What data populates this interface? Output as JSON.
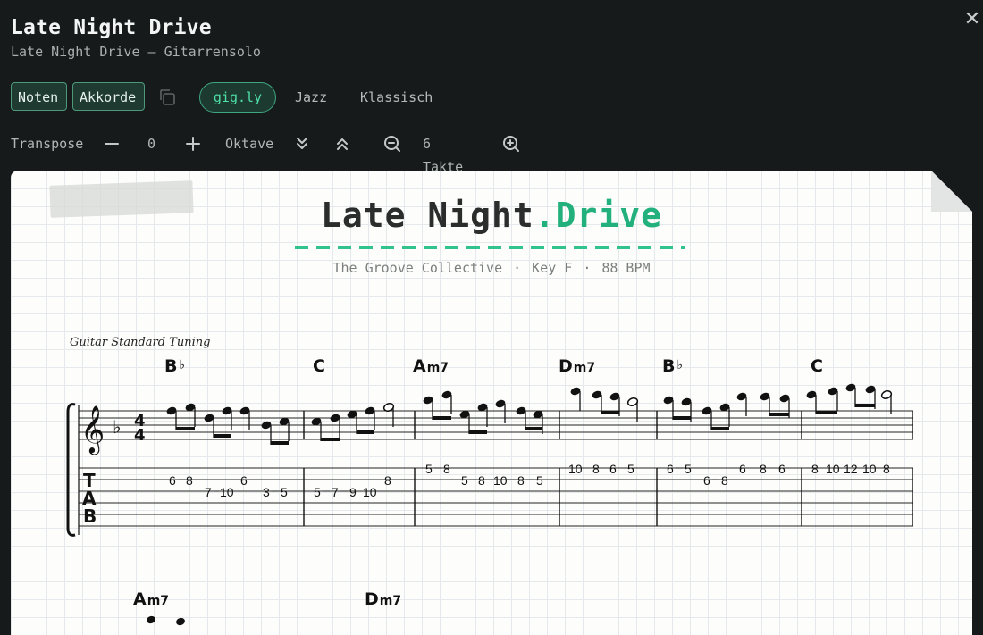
{
  "header": {
    "title": "Late Night Drive",
    "subtitle": "Late Night Drive — Gitarrensolo",
    "close_glyph": "✕"
  },
  "toolbar": {
    "view_buttons": [
      "Noten",
      "Akkorde"
    ],
    "style_tabs": [
      {
        "label": "gig.ly",
        "active": true
      },
      {
        "label": "Jazz",
        "active": false
      },
      {
        "label": "Klassisch",
        "active": false
      }
    ],
    "copy_icon": "copy-icon"
  },
  "controls": {
    "transpose_label": "Transpose",
    "transpose_value": "0",
    "octave_label": "Oktave",
    "bars_label": "6 Takte",
    "icons": [
      "minus-icon",
      "plus-icon",
      "chevrons-down-icon",
      "chevrons-up-icon",
      "zoom-out-icon",
      "zoom-in-icon"
    ]
  },
  "sheet": {
    "title_a": "Late Night",
    "title_dot": ".",
    "title_b": "Drive",
    "artist": "The Groove Collective",
    "sep": "·",
    "key": "Key F",
    "tempo": "88 BPM",
    "tuning": "Guitar Standard Tuning",
    "accent_color": "#22b07d",
    "time_signature": "4/4",
    "key_signature": "♭",
    "tab_label": [
      "T",
      "A",
      "B"
    ],
    "measures": [
      {
        "chords": [
          {
            "root": "B",
            "suffix": "♭"
          }
        ],
        "frets": [
          "6",
          "8",
          "7",
          "10",
          "6",
          "3",
          "5"
        ]
      },
      {
        "chords": [
          {
            "root": "C",
            "suffix": ""
          }
        ],
        "frets": [
          "5",
          "7",
          "9",
          "10",
          "8"
        ]
      },
      {
        "chords": [
          {
            "root": "A",
            "suffix": "m7"
          }
        ],
        "frets": [
          "5",
          "8",
          "5",
          "8",
          "10",
          "8",
          "5"
        ]
      },
      {
        "chords": [
          {
            "root": "D",
            "suffix": "m7"
          }
        ],
        "frets": [
          "10",
          "8",
          "6",
          "5"
        ]
      },
      {
        "chords": [
          {
            "root": "B",
            "suffix": "♭"
          }
        ],
        "frets": [
          "6",
          "5",
          "6",
          "8",
          "6",
          "8",
          "6"
        ]
      },
      {
        "chords": [
          {
            "root": "C",
            "suffix": ""
          }
        ],
        "frets": [
          "8",
          "10",
          "12",
          "10",
          "8"
        ]
      }
    ],
    "next_system_chords": [
      {
        "root": "A",
        "suffix": "m7"
      },
      {
        "root": "D",
        "suffix": "m7"
      }
    ]
  }
}
